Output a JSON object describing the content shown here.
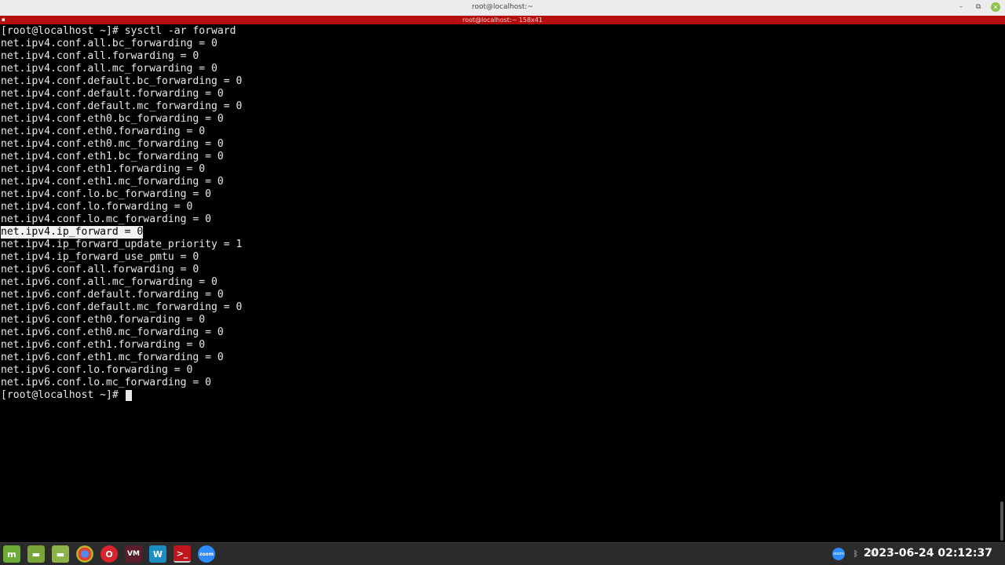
{
  "window": {
    "title": "root@localhost:~",
    "tab_title": "root@localhost:~ 158x41",
    "controls": {
      "minimize": "–",
      "maximize": "⧉",
      "close": "✕"
    }
  },
  "terminal": {
    "lines": [
      "[root@localhost ~]# sysctl -ar forward",
      "net.ipv4.conf.all.bc_forwarding = 0",
      "net.ipv4.conf.all.forwarding = 0",
      "net.ipv4.conf.all.mc_forwarding = 0",
      "net.ipv4.conf.default.bc_forwarding = 0",
      "net.ipv4.conf.default.forwarding = 0",
      "net.ipv4.conf.default.mc_forwarding = 0",
      "net.ipv4.conf.eth0.bc_forwarding = 0",
      "net.ipv4.conf.eth0.forwarding = 0",
      "net.ipv4.conf.eth0.mc_forwarding = 0",
      "net.ipv4.conf.eth1.bc_forwarding = 0",
      "net.ipv4.conf.eth1.forwarding = 0",
      "net.ipv4.conf.eth1.mc_forwarding = 0",
      "net.ipv4.conf.lo.bc_forwarding = 0",
      "net.ipv4.conf.lo.forwarding = 0",
      "net.ipv4.conf.lo.mc_forwarding = 0",
      "net.ipv4.ip_forward = 0",
      "net.ipv4.ip_forward_update_priority = 1",
      "net.ipv4.ip_forward_use_pmtu = 0",
      "net.ipv6.conf.all.forwarding = 0",
      "net.ipv6.conf.all.mc_forwarding = 0",
      "net.ipv6.conf.default.forwarding = 0",
      "net.ipv6.conf.default.mc_forwarding = 0",
      "net.ipv6.conf.eth0.forwarding = 0",
      "net.ipv6.conf.eth0.mc_forwarding = 0",
      "net.ipv6.conf.eth1.forwarding = 0",
      "net.ipv6.conf.eth1.mc_forwarding = 0",
      "net.ipv6.conf.lo.forwarding = 0",
      "net.ipv6.conf.lo.mc_forwarding = 0"
    ],
    "selected_line": 16,
    "prompt": "[root@localhost ~]# "
  },
  "taskbar": {
    "launchers": [
      {
        "name": "mint-menu-icon",
        "glyph": "m"
      },
      {
        "name": "files-icon",
        "glyph": "▬"
      },
      {
        "name": "home-folder-icon",
        "glyph": "▬"
      },
      {
        "name": "chrome-icon",
        "glyph": ""
      },
      {
        "name": "opera-icon",
        "glyph": "O"
      },
      {
        "name": "virtualbox-icon",
        "glyph": "VM"
      },
      {
        "name": "wm-app-icon",
        "glyph": "W"
      },
      {
        "name": "terminal-icon",
        "glyph": ">_"
      },
      {
        "name": "zoom-icon",
        "glyph": "zoom"
      }
    ],
    "tray": {
      "zoom_label": "zoom",
      "bluetooth_glyph": "ᛒ",
      "shield_glyph": "⛨"
    },
    "clock": "2023-06-24 02:12:37"
  }
}
